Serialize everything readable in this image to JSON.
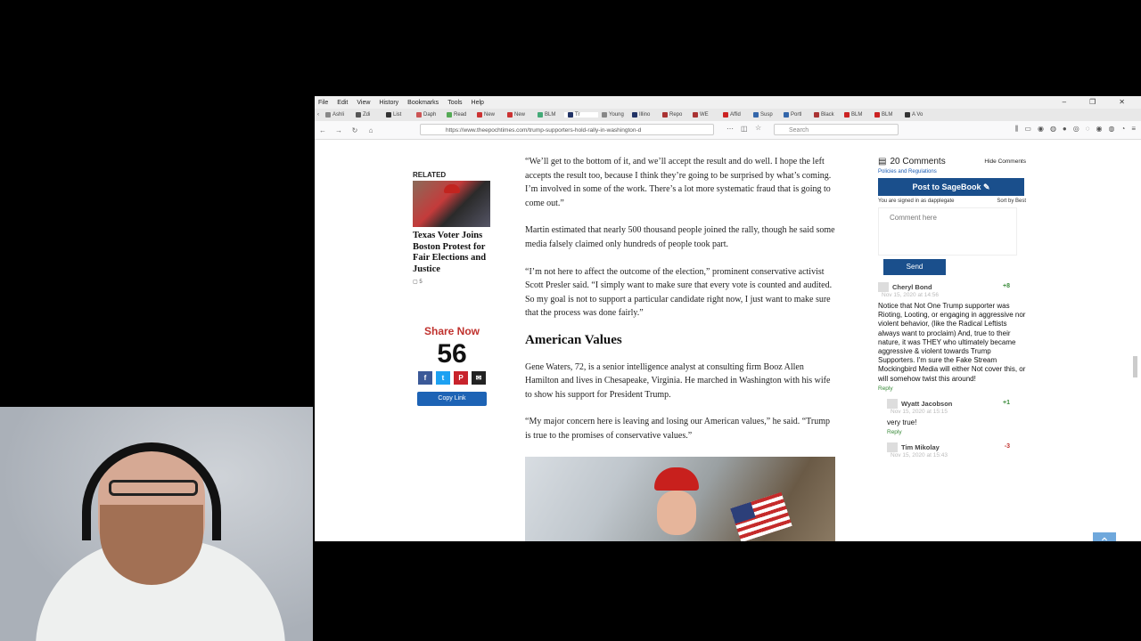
{
  "menu": {
    "file": "File",
    "edit": "Edit",
    "view": "View",
    "history": "History",
    "bookmarks": "Bookmarks",
    "tools": "Tools",
    "help": "Help"
  },
  "tabs": [
    "Ashli",
    "Zdi",
    "List",
    "Daph",
    "Read",
    "New",
    "New",
    "BLM",
    "Tr",
    "Young",
    "Illino",
    "Repo",
    "WE",
    "Affid",
    "Susp",
    "Portl",
    "Black",
    "BLM",
    "BLM",
    "A Vo"
  ],
  "url": "https://www.theepochtimes.com/trump-supporters-hold-rally-in-washington-d",
  "search_placeholder": "Search",
  "related": {
    "header": "RELATED",
    "title": "Texas Voter Joins Boston Protest for Fair Elections and Justice",
    "comment_count": "5"
  },
  "share": {
    "label": "Share Now",
    "count": "56",
    "copy_link": "Copy Link"
  },
  "article": {
    "p1": "“We’ll get to the bottom of it, and we’ll accept the result and do well. I hope the left accepts the result too, because I think they’re going to be surprised by what’s coming. I’m involved in some of the work. There’s a lot more systematic fraud that is going to come out.”",
    "p2": "Martin estimated that nearly 500 thousand people joined the rally, though he said some media falsely claimed only hundreds of people took part.",
    "p3": "“I’m not here to affect the outcome of the election,” prominent conservative activist Scott Presler said. “I simply want to make sure that every vote is counted and audited. So my goal is not to support a particular candidate right now, I just want to make sure that the process was done fairly.”",
    "heading": "American Values",
    "p4": "Gene Waters, 72, is a senior intelligence analyst at consulting firm Booz Allen Hamilton and lives in Chesapeake, Virginia. He marched in Washington with his wife to show his support for President Trump.",
    "p5": "“My major concern here is leaving and losing our American values,” he said. “Trump is true to the promises of conservative values.”"
  },
  "comments": {
    "count_label": "20 Comments",
    "hide_label": "Hide Comments",
    "policies": "Policies and Regulations",
    "post_button": "Post to SageBook",
    "signed_in": "You are signed in as dapplegate",
    "sort": "Sort by Best",
    "placeholder": "Comment here",
    "send": "Send",
    "items": [
      {
        "name": "Cheryl Bond",
        "date": "Nov 15, 2020 at 14:56",
        "score": "+8",
        "text": "Notice that Not One Trump supporter was Rioting, Looting, or engaging in aggressive nor violent behavior, (like the Radical Leftists always want to proclaim) And, true to their nature, it was THEY who ultimately became aggressive & violent towards Trump Supporters. I'm sure the Fake Stream Mockingbird Media will either Not cover this, or will somehow twist this around!",
        "reply": "Reply"
      },
      {
        "name": "Wyatt Jacobson",
        "date": "Nov 15, 2020 at 15:15",
        "score": "+1",
        "text": "very true!",
        "reply": "Reply"
      },
      {
        "name": "Tim Mikolay",
        "date": "Nov 15, 2020 at 15:43",
        "score": "-3",
        "text": "",
        "reply": ""
      }
    ]
  },
  "colors": {
    "accent": "#1a4f8c",
    "share_red": "#c0322e",
    "positive": "#3a8b3a",
    "negative": "#c0322e"
  }
}
